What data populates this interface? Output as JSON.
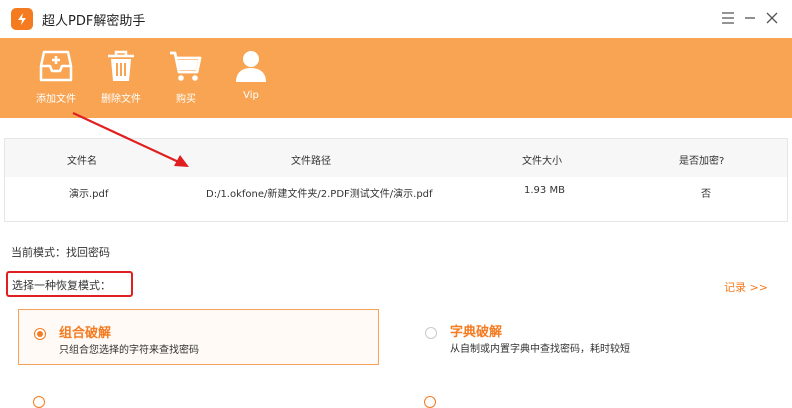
{
  "app": {
    "title": "超人PDF解密助手"
  },
  "toolbar": {
    "items": [
      {
        "label": "添加文件",
        "icon": "inbox-add-icon"
      },
      {
        "label": "删除文件",
        "icon": "trash-icon"
      },
      {
        "label": "购买",
        "icon": "cart-icon"
      },
      {
        "label": "Vip",
        "icon": "user-icon"
      }
    ]
  },
  "table": {
    "headers": [
      "文件名",
      "文件路径",
      "文件大小",
      "是否加密?"
    ],
    "rows": [
      [
        "演示.pdf",
        "D:/1.okfone/新建文件夹/2.PDF测试文件/演示.pdf",
        "1.93 MB",
        "否"
      ]
    ]
  },
  "mode": {
    "current": "当前模式：找回密码",
    "choose": "选择一种恢复模式：",
    "record": "记录 >>"
  },
  "options": [
    {
      "title": "组合破解",
      "desc": "只组合您选择的字符来查找密码",
      "selected": true
    },
    {
      "title": "字典破解",
      "desc": "从自制或内置字典中查找密码，耗时较短",
      "selected": false
    }
  ],
  "colors": {
    "accent": "#f47b20",
    "toolbar": "#f8a452",
    "annotation": "#e02020"
  }
}
